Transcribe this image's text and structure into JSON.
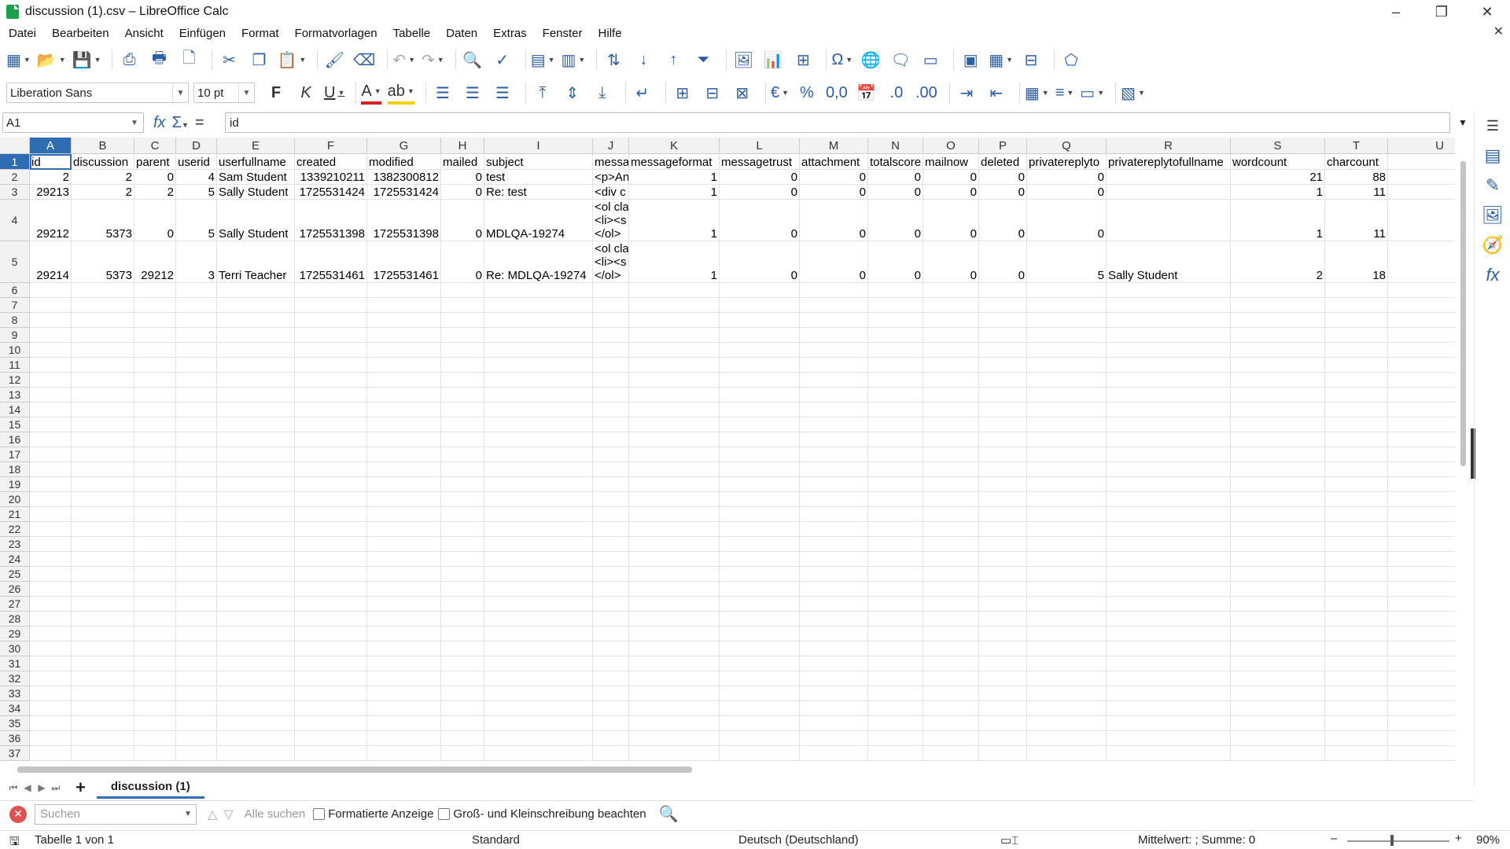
{
  "window": {
    "title": "discussion (1).csv – LibreOffice Calc",
    "minimize": "–",
    "maximize": "❐",
    "close": "✕",
    "doc_close": "✕"
  },
  "menu": [
    "Datei",
    "Bearbeiten",
    "Ansicht",
    "Einfügen",
    "Format",
    "Formatvorlagen",
    "Tabelle",
    "Daten",
    "Extras",
    "Fenster",
    "Hilfe"
  ],
  "toolbar": {
    "font_name": "Liberation Sans",
    "font_size": "10 pt",
    "bold": "F",
    "italic": "K",
    "underline": "U"
  },
  "formula_bar": {
    "name_box": "A1",
    "content": "id"
  },
  "columns": [
    "A",
    "B",
    "C",
    "D",
    "E",
    "F",
    "G",
    "H",
    "I",
    "J",
    "K",
    "L",
    "M",
    "N",
    "O",
    "P",
    "Q",
    "R",
    "S",
    "T",
    "U"
  ],
  "rows": [
    [
      "id",
      "discussion",
      "parent",
      "userid",
      "userfullname",
      "created",
      "modified",
      "mailed",
      "subject",
      "messa",
      "messageformat",
      "messagetrust",
      "attachment",
      "totalscore",
      "mailnow",
      "deleted",
      "privatereplyto",
      "privatereplytofullname",
      "wordcount",
      "charcount",
      ""
    ],
    [
      "2",
      "2",
      "0",
      "4",
      "Sam Student",
      "1339210211",
      "1382300812",
      "0",
      "test",
      "<p>An",
      "1",
      "0",
      "0",
      "0",
      "0",
      "0",
      "0",
      "",
      "21",
      "88",
      ""
    ],
    [
      "29213",
      "2",
      "2",
      "5",
      "Sally Student",
      "1725531424",
      "1725531424",
      "0",
      "Re: test",
      "<div c",
      "1",
      "0",
      "0",
      "0",
      "0",
      "0",
      "0",
      "",
      "1",
      "11",
      ""
    ],
    [
      "29212",
      "5373",
      "0",
      "5",
      "Sally Student",
      "1725531398",
      "1725531398",
      "0",
      "MDLQA-19274",
      "<ol cla|<li><s|</ol>",
      "1",
      "0",
      "0",
      "0",
      "0",
      "0",
      "0",
      "",
      "1",
      "11",
      ""
    ],
    [
      "29214",
      "5373",
      "29212",
      "3",
      "Terri Teacher",
      "1725531461",
      "1725531461",
      "0",
      "Re: MDLQA-19274",
      "<ol cla|<li><s|</ol>",
      "1",
      "0",
      "0",
      "0",
      "0",
      "0",
      "5",
      "Sally Student",
      "2",
      "18",
      ""
    ]
  ],
  "sheet_tab": "discussion (1)",
  "find": {
    "placeholder": "Suchen",
    "find_all": "Alle suchen",
    "formatted": "Formatierte Anzeige",
    "match_case": "Groß- und Kleinschreibung beachten"
  },
  "status": {
    "sheet": "Tabelle 1 von 1",
    "style": "Standard",
    "language": "Deutsch (Deutschland)",
    "sum": "Mittelwert: ; Summe: 0",
    "zoom": "90%",
    "zoom_minus": "–",
    "zoom_plus": "+"
  },
  "colors": {
    "accent": "#2e6db4",
    "header_bg": "#f2f2f2"
  },
  "icons": [
    "new-icon",
    "open-icon",
    "save-icon",
    "export-pdf-icon",
    "print-icon",
    "print-preview-icon",
    "cut-icon",
    "copy-icon",
    "paste-icon",
    "clone-format-icon",
    "clear-format-icon",
    "undo-icon",
    "redo-icon",
    "find-replace-icon",
    "spelling-icon",
    "row-icon",
    "column-icon",
    "sort-icon",
    "sort-asc-icon",
    "sort-desc-icon",
    "autofilter-icon",
    "image-icon",
    "chart-icon",
    "pivot-icon",
    "special-char-icon",
    "hyperlink-icon",
    "comment-icon",
    "header-footer-icon",
    "define-print-area-icon",
    "freeze-icon",
    "split-window-icon",
    "show-draw-icon"
  ]
}
